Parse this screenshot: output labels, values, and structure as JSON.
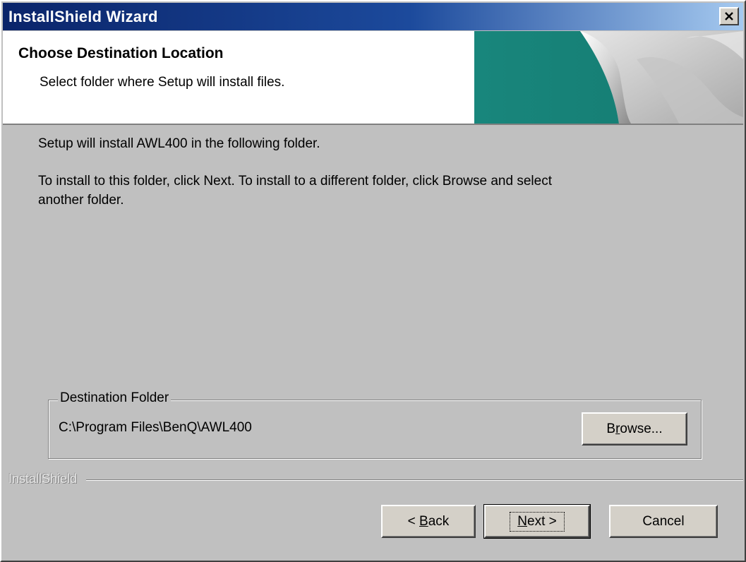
{
  "window": {
    "title": "InstallShield Wizard"
  },
  "header": {
    "title": "Choose Destination Location",
    "subtitle": "Select folder where Setup will install files."
  },
  "content": {
    "intro": "Setup will install AWL400 in the following folder.",
    "instructions_line1": "To install to this folder, click Next. To install to a different folder, click Browse and select",
    "instructions_line2": "another folder."
  },
  "destination": {
    "legend": "Destination Folder",
    "path": "C:\\Program Files\\BenQ\\AWL400",
    "browse_pre": "B",
    "browse_ul": "r",
    "browse_post": "owse..."
  },
  "footer": {
    "brand": "InstallShield",
    "back_pre": "< ",
    "back_ul": "B",
    "back_post": "ack",
    "next_ul": "N",
    "next_post": "ext >",
    "cancel": "Cancel"
  },
  "colors": {
    "titlebar_start": "#0a246a",
    "titlebar_end": "#a6caf0",
    "teal_art": "#18867c",
    "dialog_bg": "#c0c0c0"
  },
  "icons": {
    "close": "close-icon",
    "header_art": "page-curl-graphic"
  }
}
